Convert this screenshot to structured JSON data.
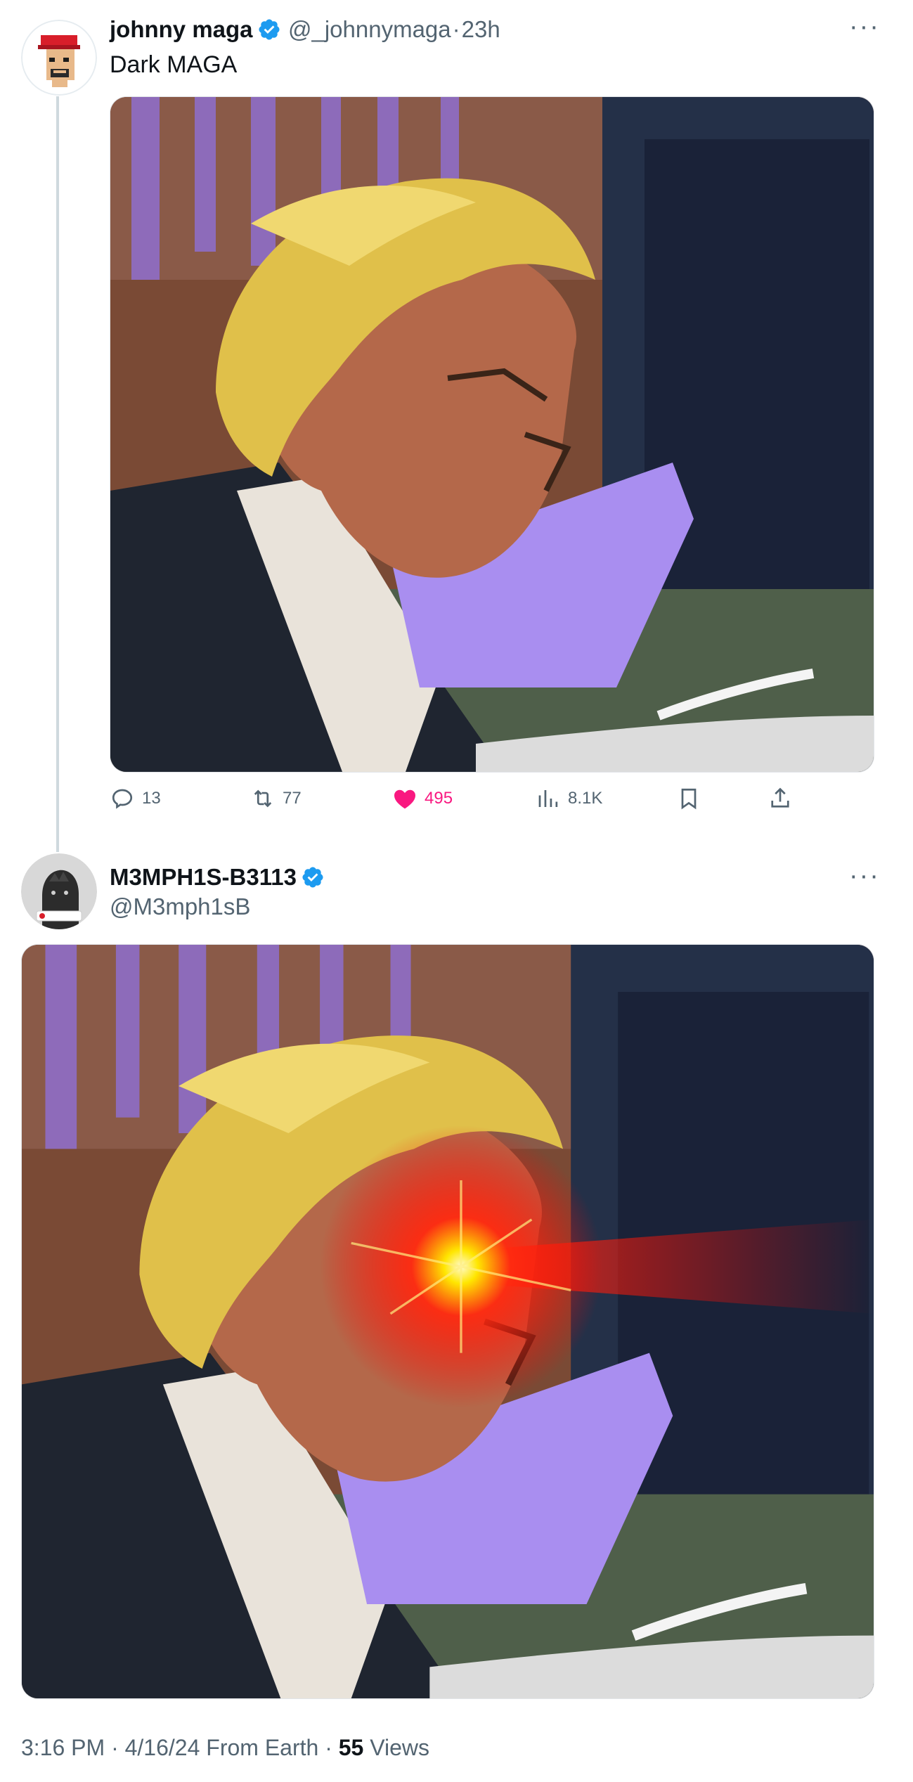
{
  "tweet1": {
    "display_name": "johnny maga",
    "handle": "@_johnnymaga",
    "separator": "·",
    "time_ago": "23h",
    "text": "Dark MAGA",
    "media_alt": "Courtroom sketch of a man in profile",
    "actions": {
      "replies": "13",
      "retweets": "77",
      "likes": "495",
      "views": "8.1K"
    }
  },
  "tweet2": {
    "display_name": "M3MPH1S-B3113",
    "handle": "@M3mph1sB",
    "media_alt": "Courtroom sketch edited with glowing red laser eye"
  },
  "footer": {
    "time": "3:16 PM",
    "sep1": "·",
    "date": "4/16/24",
    "source": "From Earth",
    "sep2": "·",
    "views_count": "55",
    "views_label": "Views"
  },
  "colors": {
    "accent_verified": "#1d9bf0",
    "like_pink": "#f91880",
    "secondary_text": "#536471"
  },
  "icons": [
    "verified-badge-icon",
    "more-icon",
    "reply-icon",
    "retweet-icon",
    "like-icon",
    "views-icon",
    "bookmark-icon",
    "share-icon"
  ]
}
